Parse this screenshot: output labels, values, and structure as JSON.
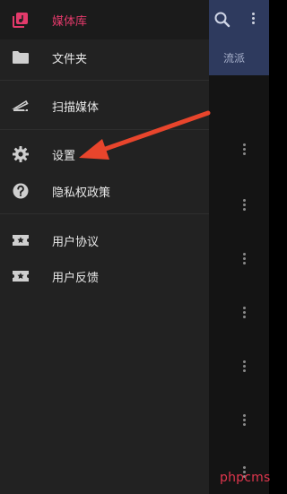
{
  "background": {
    "tab_label": "流派",
    "toolbar_color": "#2e3a5e",
    "icons": [
      "search-icon",
      "more-vert-icon"
    ]
  },
  "drawer": {
    "accent_color": "#e43a6b",
    "items": [
      {
        "label": "媒体库",
        "icon": "library-icon",
        "active": true
      },
      {
        "label": "文件夹",
        "icon": "folder-icon",
        "active": false
      },
      {
        "label": "扫描媒体",
        "icon": "scan-icon",
        "active": false
      },
      {
        "label": "设置",
        "icon": "gear-icon",
        "active": false
      },
      {
        "label": "隐私权政策",
        "icon": "help-icon",
        "active": false
      },
      {
        "label": "用户协议",
        "icon": "ticket-icon",
        "active": false
      },
      {
        "label": "用户反馈",
        "icon": "ticket-icon",
        "active": false
      }
    ]
  },
  "annotation": {
    "arrow_color": "#e8452c",
    "points_to": "设置"
  },
  "watermark": "phpcms"
}
